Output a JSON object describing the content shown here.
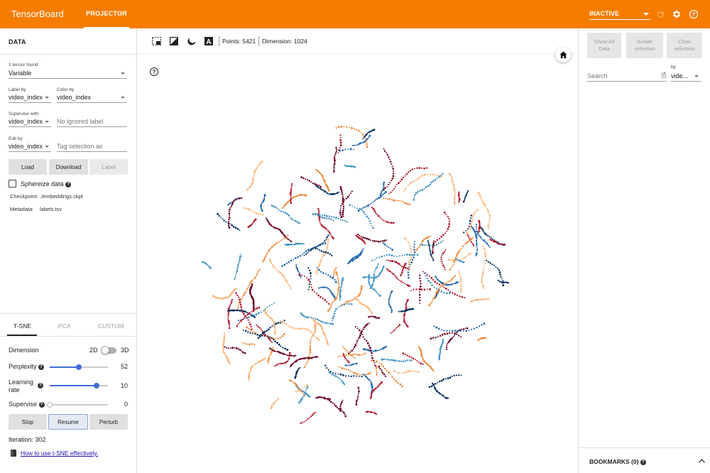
{
  "app": {
    "brand": "TensorBoard",
    "tab": "PROJECTOR",
    "run_status": "INACTIVE",
    "accent_color": "#f57c00"
  },
  "left": {
    "section_title": "DATA",
    "tensor_found": "1 tensor found",
    "tensor_value": "Variable",
    "label_by_caption": "Label by",
    "label_by_value": "video_index",
    "color_by_caption": "Color by",
    "color_by_value": "video_index",
    "supervise_with_caption": "Supervise with",
    "supervise_with_value": "video_index",
    "ignored_label_placeholder": "No ignored label",
    "edit_by_caption": "Edit by",
    "edit_by_value": "video_index",
    "tag_selection_placeholder": "Tag selection as",
    "load_button": "Load",
    "download_button": "Download",
    "label_button": "Label",
    "sphereize_label": "Sphereize data",
    "checkpoint_caption": "Checkpoint:",
    "checkpoint_value": "./embeddings.ckpt",
    "metadata_caption": "Metadata:",
    "metadata_value": "labels.tsv",
    "tabs": [
      "T-SNE",
      "PCA",
      "CUSTOM"
    ],
    "tsne": {
      "dimension_label": "Dimension",
      "dim_2d": "2D",
      "dim_3d": "3D",
      "perplexity_label": "Perplexity",
      "perplexity_value": "52",
      "perplexity_fraction": 0.5,
      "learning_rate_label_1": "Learning",
      "learning_rate_label_2": "rate",
      "learning_rate_value": "10",
      "learning_rate_fraction": 0.8,
      "supervise_label": "Supervise",
      "supervise_value": "0",
      "supervise_fraction": 0.0,
      "stop_button": "Stop",
      "resume_button": "Resume",
      "perturb_button": "Perturb",
      "iteration_text": "Iteration: 302",
      "help_link": "How to use t-SNE effectively."
    }
  },
  "toolbar": {
    "points_text": "Points: 5421",
    "dimension_text": "Dimension: 1024"
  },
  "right": {
    "show_all_line1": "Show All",
    "show_all_line2": "Data",
    "isolate_line1": "Isolate",
    "isolate_line2": "selection",
    "clear_line1": "Clear",
    "clear_line2": "selection",
    "search_placeholder": "Search",
    "by_caption": "by",
    "by_value": "vide...",
    "bookmarks_title": "BOOKMARKS (0)"
  },
  "scatter_colors": [
    "#b2182b",
    "#ef8a3c",
    "#fdb47a",
    "#2166ac",
    "#4393c3",
    "#053061",
    "#67001f"
  ]
}
